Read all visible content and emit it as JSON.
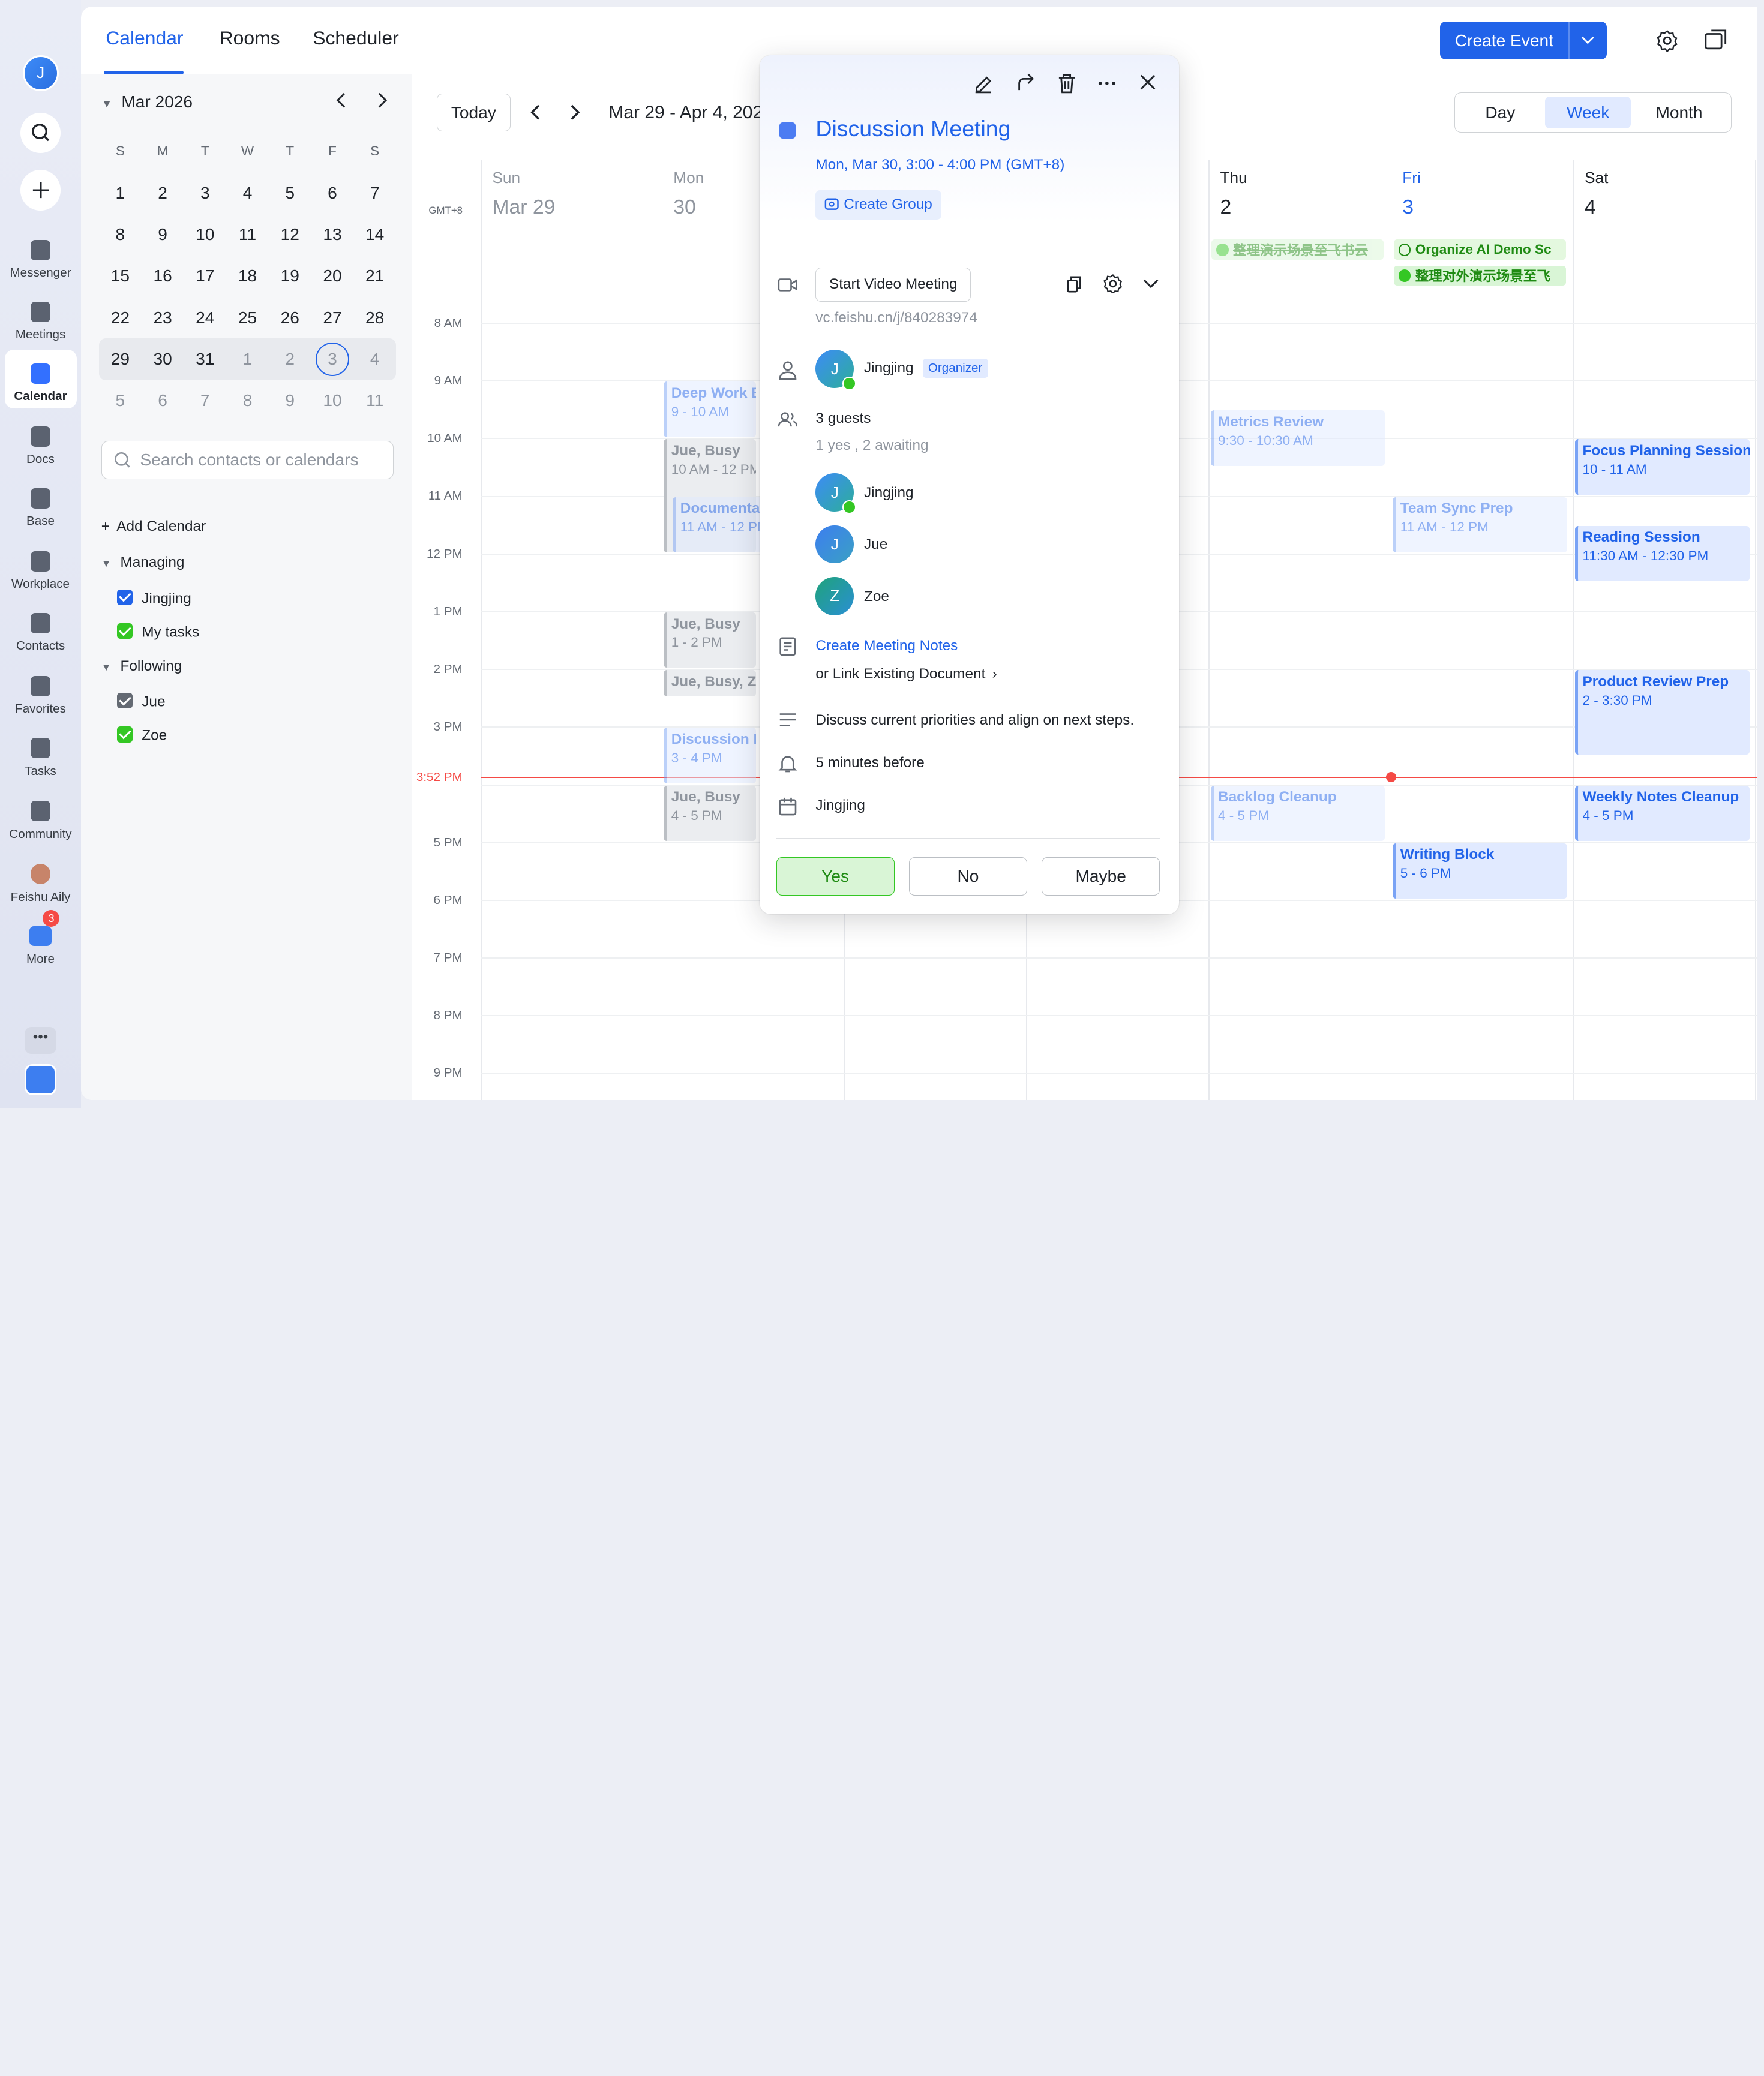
{
  "topnav": {
    "tabs": [
      "Calendar",
      "Rooms",
      "Scheduler"
    ],
    "create": "Create Event"
  },
  "rail": {
    "avatar": "J",
    "items": [
      {
        "label": "Messenger",
        "icon": "messenger-icon"
      },
      {
        "label": "Meetings",
        "icon": "meetings-icon"
      },
      {
        "label": "Calendar",
        "icon": "calendar-icon",
        "active": true
      },
      {
        "label": "Docs",
        "icon": "docs-icon"
      },
      {
        "label": "Base",
        "icon": "base-icon"
      },
      {
        "label": "Workplace",
        "icon": "workplace-icon"
      },
      {
        "label": "Contacts",
        "icon": "contacts-icon"
      },
      {
        "label": "Favorites",
        "icon": "favorites-icon"
      },
      {
        "label": "Tasks",
        "icon": "tasks-icon"
      },
      {
        "label": "Community",
        "icon": "community-icon"
      },
      {
        "label": "Feishu Aily",
        "icon": "aily-icon"
      },
      {
        "label": "More",
        "icon": "more-icon"
      }
    ],
    "more_badge": "3"
  },
  "minical": {
    "month": "Mar 2026",
    "dow": [
      "S",
      "M",
      "T",
      "W",
      "T",
      "F",
      "S"
    ],
    "weeks": [
      [
        "1",
        "2",
        "3",
        "4",
        "5",
        "6",
        "7"
      ],
      [
        "8",
        "9",
        "10",
        "11",
        "12",
        "13",
        "14"
      ],
      [
        "15",
        "16",
        "17",
        "18",
        "19",
        "20",
        "21"
      ],
      [
        "22",
        "23",
        "24",
        "25",
        "26",
        "27",
        "28"
      ],
      [
        "29",
        "30",
        "31",
        "1",
        "2",
        "3",
        "4"
      ],
      [
        "5",
        "6",
        "7",
        "8",
        "9",
        "10",
        "11"
      ]
    ]
  },
  "sidebar": {
    "search_placeholder": "Search contacts or calendars",
    "add_calendar": "Add Calendar",
    "managing": "Managing",
    "managing_items": [
      {
        "label": "Jingjing",
        "color": "#2163e9"
      },
      {
        "label": "My tasks",
        "color": "#34c724"
      }
    ],
    "following": "Following",
    "following_items": [
      {
        "label": "Jue",
        "color": "#646a73"
      },
      {
        "label": "Zoe",
        "color": "#34c724"
      }
    ]
  },
  "toolbar": {
    "today": "Today",
    "range": "Mar 29 - Apr 4, 2026",
    "views": [
      "Day",
      "Week",
      "Month"
    ],
    "active_view": "Week"
  },
  "week": {
    "tz": "GMT+8",
    "days": [
      {
        "dow": "Sun",
        "num": "Mar 29"
      },
      {
        "dow": "Mon",
        "num": "30"
      },
      {
        "dow": "Tue",
        "num": "31"
      },
      {
        "dow": "Wed",
        "num": "1"
      },
      {
        "dow": "Thu",
        "num": "2"
      },
      {
        "dow": "Fri",
        "num": "3"
      },
      {
        "dow": "Sat",
        "num": "4"
      }
    ],
    "hours": [
      "8 AM",
      "9 AM",
      "10 AM",
      "11 AM",
      "12 PM",
      "1 PM",
      "2 PM",
      "3 PM",
      "",
      "5 PM",
      "6 PM",
      "7 PM",
      "8 PM",
      "9 PM"
    ],
    "now": "3:52 PM",
    "allday": [
      {
        "day": 4,
        "label": "整理演示场景至飞书云",
        "done": true
      },
      {
        "day": 5,
        "label": "Organize AI Demo Sc",
        "done": false
      },
      {
        "day": 5,
        "label": "整理对外演示场景至飞",
        "done": true
      }
    ],
    "events": [
      {
        "day": 1,
        "title": "Deep Work B",
        "time": "9 - 10 AM",
        "start": 9,
        "end": 10,
        "kind": "faded"
      },
      {
        "day": 1,
        "title": "Jue, Busy",
        "time": "10 AM - 12 PM",
        "start": 10,
        "end": 12,
        "kind": "busy"
      },
      {
        "day": 1,
        "title": "Documenta",
        "time": "11 AM - 12 PM",
        "start": 11,
        "end": 12,
        "kind": "faded",
        "inset": true
      },
      {
        "day": 1,
        "title": "Jue, Busy",
        "time": "1 - 2 PM",
        "start": 13,
        "end": 14,
        "kind": "busy"
      },
      {
        "day": 1,
        "title": "Jue, Busy, Z",
        "time": "",
        "start": 14,
        "end": 14.5,
        "kind": "busy"
      },
      {
        "day": 1,
        "title": "Discussion M",
        "time": "3 - 4 PM",
        "start": 15,
        "end": 16,
        "kind": "faded"
      },
      {
        "day": 1,
        "title": "Jue, Busy",
        "time": "4 - 5 PM",
        "start": 16,
        "end": 17,
        "kind": "busy"
      },
      {
        "day": 4,
        "title": "Metrics Review",
        "time": "9:30 - 10:30 AM",
        "start": 9.5,
        "end": 10.5,
        "kind": "faded"
      },
      {
        "day": 4,
        "title": "Backlog Cleanup",
        "time": "4 - 5 PM",
        "start": 16,
        "end": 17,
        "kind": "faded"
      },
      {
        "day": 5,
        "title": "Team Sync Prep",
        "time": "11 AM - 12 PM",
        "start": 11,
        "end": 12,
        "kind": "faded"
      },
      {
        "day": 5,
        "title": "Writing Block",
        "time": "5 - 6 PM",
        "start": 17,
        "end": 18,
        "kind": "normal"
      },
      {
        "day": 6,
        "title": "Focus Planning Session",
        "time": "10 - 11 AM",
        "start": 10,
        "end": 11,
        "kind": "normal"
      },
      {
        "day": 6,
        "title": "Reading Session",
        "time": "11:30 AM - 12:30 PM",
        "start": 11.5,
        "end": 12.5,
        "kind": "normal"
      },
      {
        "day": 6,
        "title": "Product Review Prep",
        "time": "2 - 3:30 PM",
        "start": 14,
        "end": 15.5,
        "kind": "normal"
      },
      {
        "day": 6,
        "title": "Weekly Notes Cleanup",
        "time": "4 - 5 PM",
        "start": 16,
        "end": 17,
        "kind": "normal"
      }
    ]
  },
  "popup": {
    "title": "Discussion Meeting",
    "time": "Mon, Mar 30, 3:00 - 4:00 PM (GMT+8)",
    "create_group": "Create Group",
    "video_button": "Start Video Meeting",
    "video_link": "vc.feishu.cn/j/840283974",
    "organizer_name": "Jingjing",
    "organizer_badge": "Organizer",
    "guests_count": "3 guests",
    "guests_status": "1 yes , 2 awaiting",
    "guests": [
      {
        "initial": "J",
        "name": "Jingjing",
        "accepted": true,
        "color": "#3d7ef0"
      },
      {
        "initial": "J",
        "name": "Jue",
        "accepted": false,
        "color": "#3d7ef0"
      },
      {
        "initial": "Z",
        "name": "Zoe",
        "accepted": false,
        "color": "#1fa37a"
      }
    ],
    "notes_link": "Create Meeting Notes",
    "notes_existing": "or Link Existing Document",
    "description": "Discuss current priorities and align on next steps.",
    "reminder": "5 minutes before",
    "calendar": "Jingjing",
    "rsvp": [
      "Yes",
      "No",
      "Maybe"
    ]
  }
}
